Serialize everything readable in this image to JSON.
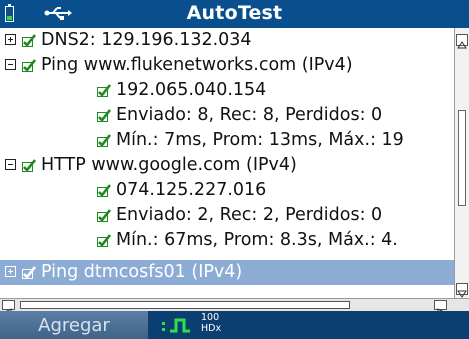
{
  "window": {
    "title": "AutoTest"
  },
  "status_icons": {
    "battery": "battery-icon",
    "usb": "usb-icon"
  },
  "tree": {
    "rows": [
      {
        "text": "DNS2: 129.196.132.034",
        "expander": "plus",
        "checked": true
      },
      {
        "text": "Ping www.flukenetworks.com (IPv4)",
        "expander": "minus",
        "checked": true
      },
      {
        "text": "192.065.040.154",
        "checked": true
      },
      {
        "text": "Enviado: 8, Rec: 8, Perdidos: 0",
        "checked": true
      },
      {
        "text": "Mín.: 7ms, Prom: 13ms, Máx.: 19",
        "checked": true
      },
      {
        "text": "HTTP www.google.com (IPv4)",
        "expander": "minus",
        "checked": true
      },
      {
        "text": "074.125.227.016",
        "checked": true
      },
      {
        "text": "Enviado: 2, Rec: 2, Perdidos: 0",
        "checked": true
      },
      {
        "text": "Mín.: 67ms, Prom: 8.3s, Máx.: 4.",
        "checked": true
      },
      {
        "text": "Ping dtmcosfs01 (IPv4)",
        "expander": "plus",
        "checked": true,
        "selected": true
      }
    ]
  },
  "bottom_bar": {
    "softkey_label": "Agregar",
    "link_speed": "100",
    "link_duplex": "HDx"
  },
  "colors": {
    "title_bar": "#0a4f8d",
    "selection": "#8cacd6",
    "check_green": "#1f8a1f",
    "link_green": "#2ee04a"
  }
}
